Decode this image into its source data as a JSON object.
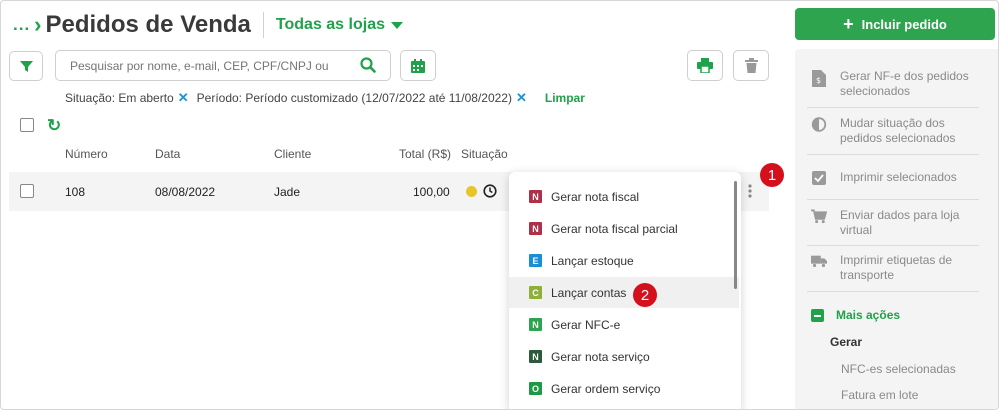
{
  "header": {
    "breadcrumb_dots": "...",
    "title": "Pedidos de Venda",
    "store_selector": "Todas as lojas",
    "include_button": "Incluir pedido"
  },
  "search": {
    "placeholder": "Pesquisar por nome, e-mail, CEP, CPF/CNPJ ou"
  },
  "filters": {
    "situation": "Situação: Em aberto",
    "period": "Período: Período customizado (12/07/2022 até 11/08/2022)",
    "clear": "Limpar"
  },
  "table": {
    "columns": [
      "Número",
      "Data",
      "Cliente",
      "Total (R$)",
      "Situação"
    ],
    "rows": [
      {
        "number": "108",
        "date": "08/08/2022",
        "client": "Jade",
        "total": "100,00",
        "status_color": "#e6c52b"
      }
    ]
  },
  "dropdown": {
    "items": [
      {
        "badge": "N",
        "color": "#b03048",
        "label": "Gerar nota fiscal"
      },
      {
        "badge": "N",
        "color": "#b03048",
        "label": "Gerar nota fiscal parcial"
      },
      {
        "badge": "E",
        "color": "#1a8fd6",
        "label": "Lançar estoque"
      },
      {
        "badge": "C",
        "color": "#8fae3a",
        "label": "Lançar contas"
      },
      {
        "badge": "N",
        "color": "#2ea44f",
        "label": "Gerar NFC-e"
      },
      {
        "badge": "N",
        "color": "#2d5a3a",
        "label": "Gerar nota serviço"
      },
      {
        "badge": "O",
        "color": "#1f9a44",
        "label": "Gerar ordem serviço"
      }
    ]
  },
  "markers": [
    "1",
    "2"
  ],
  "side_panel": {
    "items": [
      {
        "icon": "invoice-icon",
        "label_1": "Gerar NF-e dos pedidos",
        "label_2": "selecionados"
      },
      {
        "icon": "half-circle-icon",
        "label_1": "Mudar situação dos",
        "label_2": "pedidos selecionados"
      },
      {
        "icon": "checkbox-icon",
        "label_1": "Imprimir selecionados",
        "label_2": ""
      },
      {
        "icon": "cart-icon",
        "label_1": "Enviar dados para loja",
        "label_2": "virtual"
      },
      {
        "icon": "truck-icon",
        "label_1": "Imprimir etiquetas de",
        "label_2": "transporte"
      }
    ],
    "more_actions": "Mais ações",
    "generate_heading": "Gerar",
    "sub_items": [
      "NFC-es selecionadas",
      "Fatura em lote"
    ]
  },
  "colors": {
    "accent": "#1fa24a",
    "button": "#2ea44f",
    "marker": "#d3101c",
    "clear_x": "#1a93d8"
  }
}
